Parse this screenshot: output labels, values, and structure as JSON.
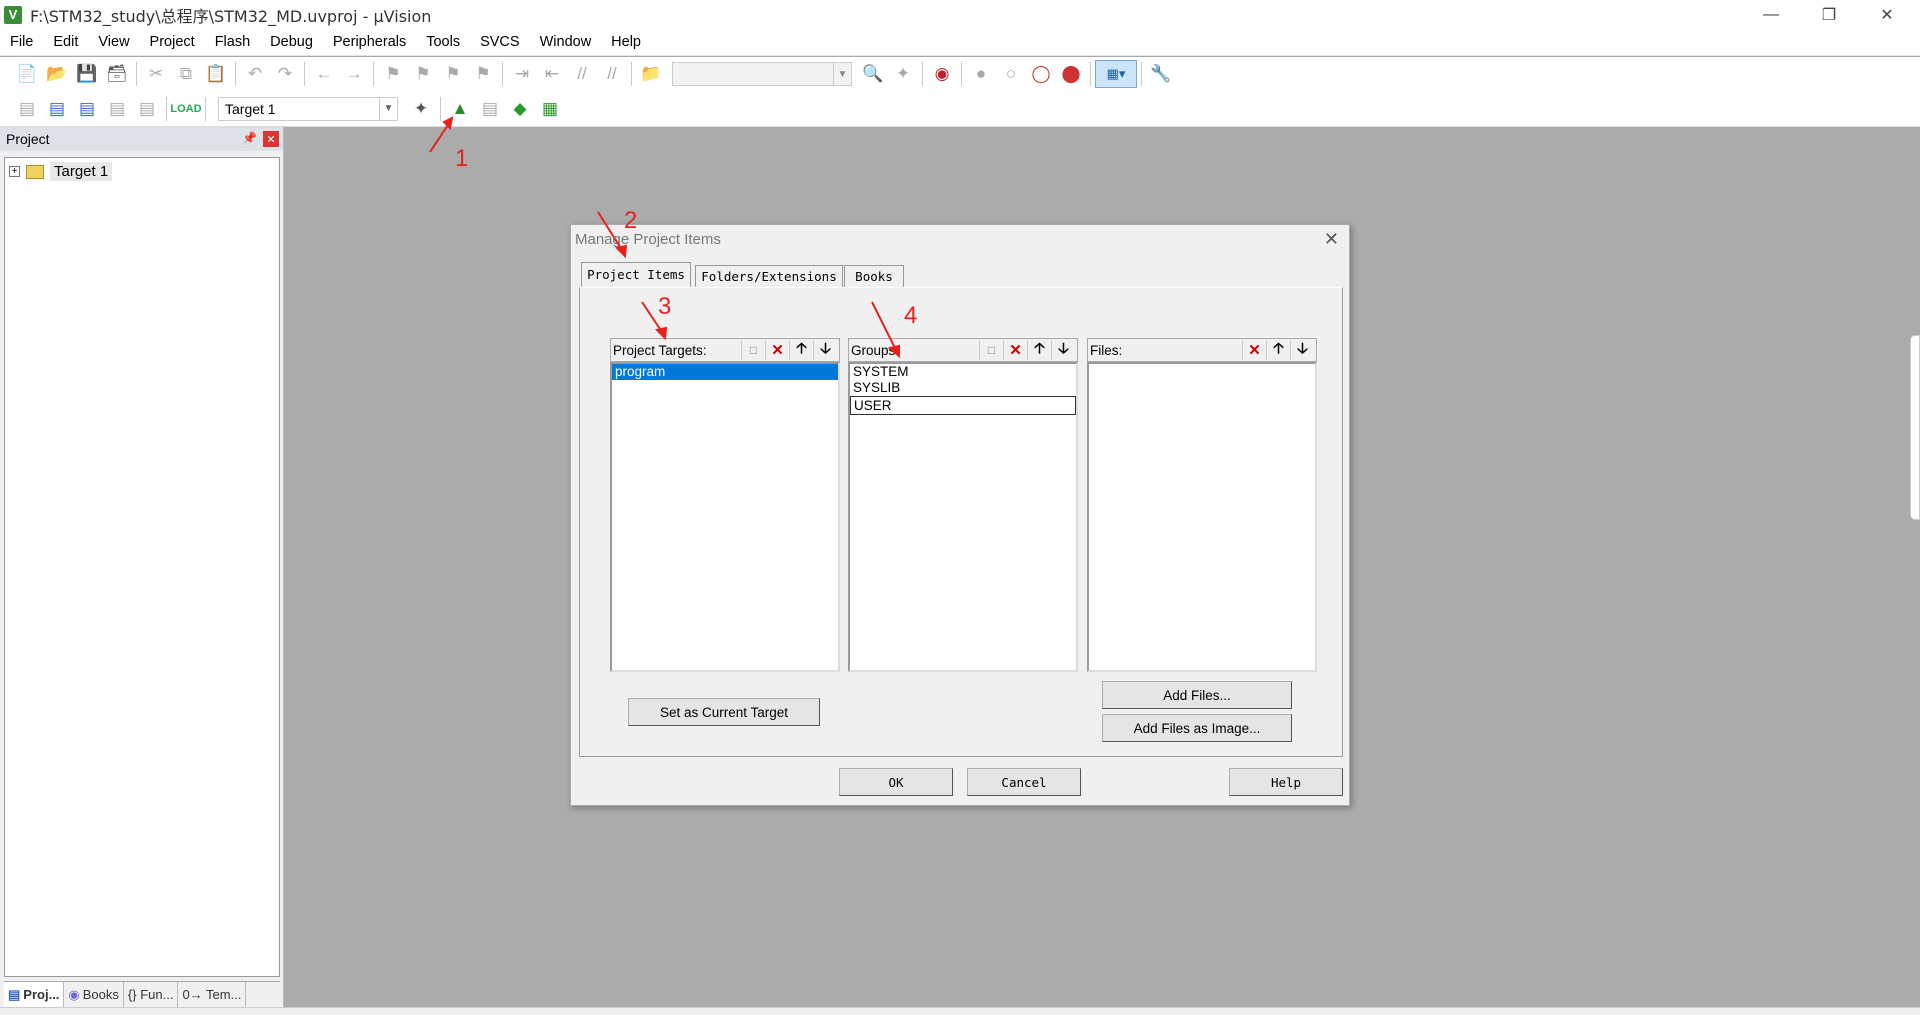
{
  "window": {
    "title": "F:\\STM32_study\\总程序\\STM32_MD.uvproj - µVision",
    "app_icon": "V"
  },
  "menu": [
    "File",
    "Edit",
    "View",
    "Project",
    "Flash",
    "Debug",
    "Peripherals",
    "Tools",
    "SVCS",
    "Window",
    "Help"
  ],
  "toolbar2": {
    "target_select": "Target 1"
  },
  "project_panel": {
    "title": "Project",
    "tree_root": "Target 1",
    "tabs": [
      "Proj...",
      "Books",
      "{} Fun...",
      "0→ Tem..."
    ]
  },
  "dialog": {
    "title": "Manage Project Items",
    "tabs": [
      "Project Items",
      "Folders/Extensions",
      "Books"
    ],
    "targets": {
      "label": "Project Targets:",
      "items": [
        "program"
      ]
    },
    "groups": {
      "label": "Groups:",
      "items": [
        "SYSTEM",
        "SYSLIB",
        "USER"
      ]
    },
    "files": {
      "label": "Files:",
      "items": []
    },
    "buttons": {
      "set_current": "Set as Current Target",
      "add_files": "Add Files...",
      "add_files_image": "Add Files as Image...",
      "ok": "OK",
      "cancel": "Cancel",
      "help": "Help"
    }
  },
  "annotations": [
    "1",
    "2",
    "3",
    "4"
  ],
  "colors": {
    "accent": "#0078d7",
    "annotation": "#e8211d"
  }
}
